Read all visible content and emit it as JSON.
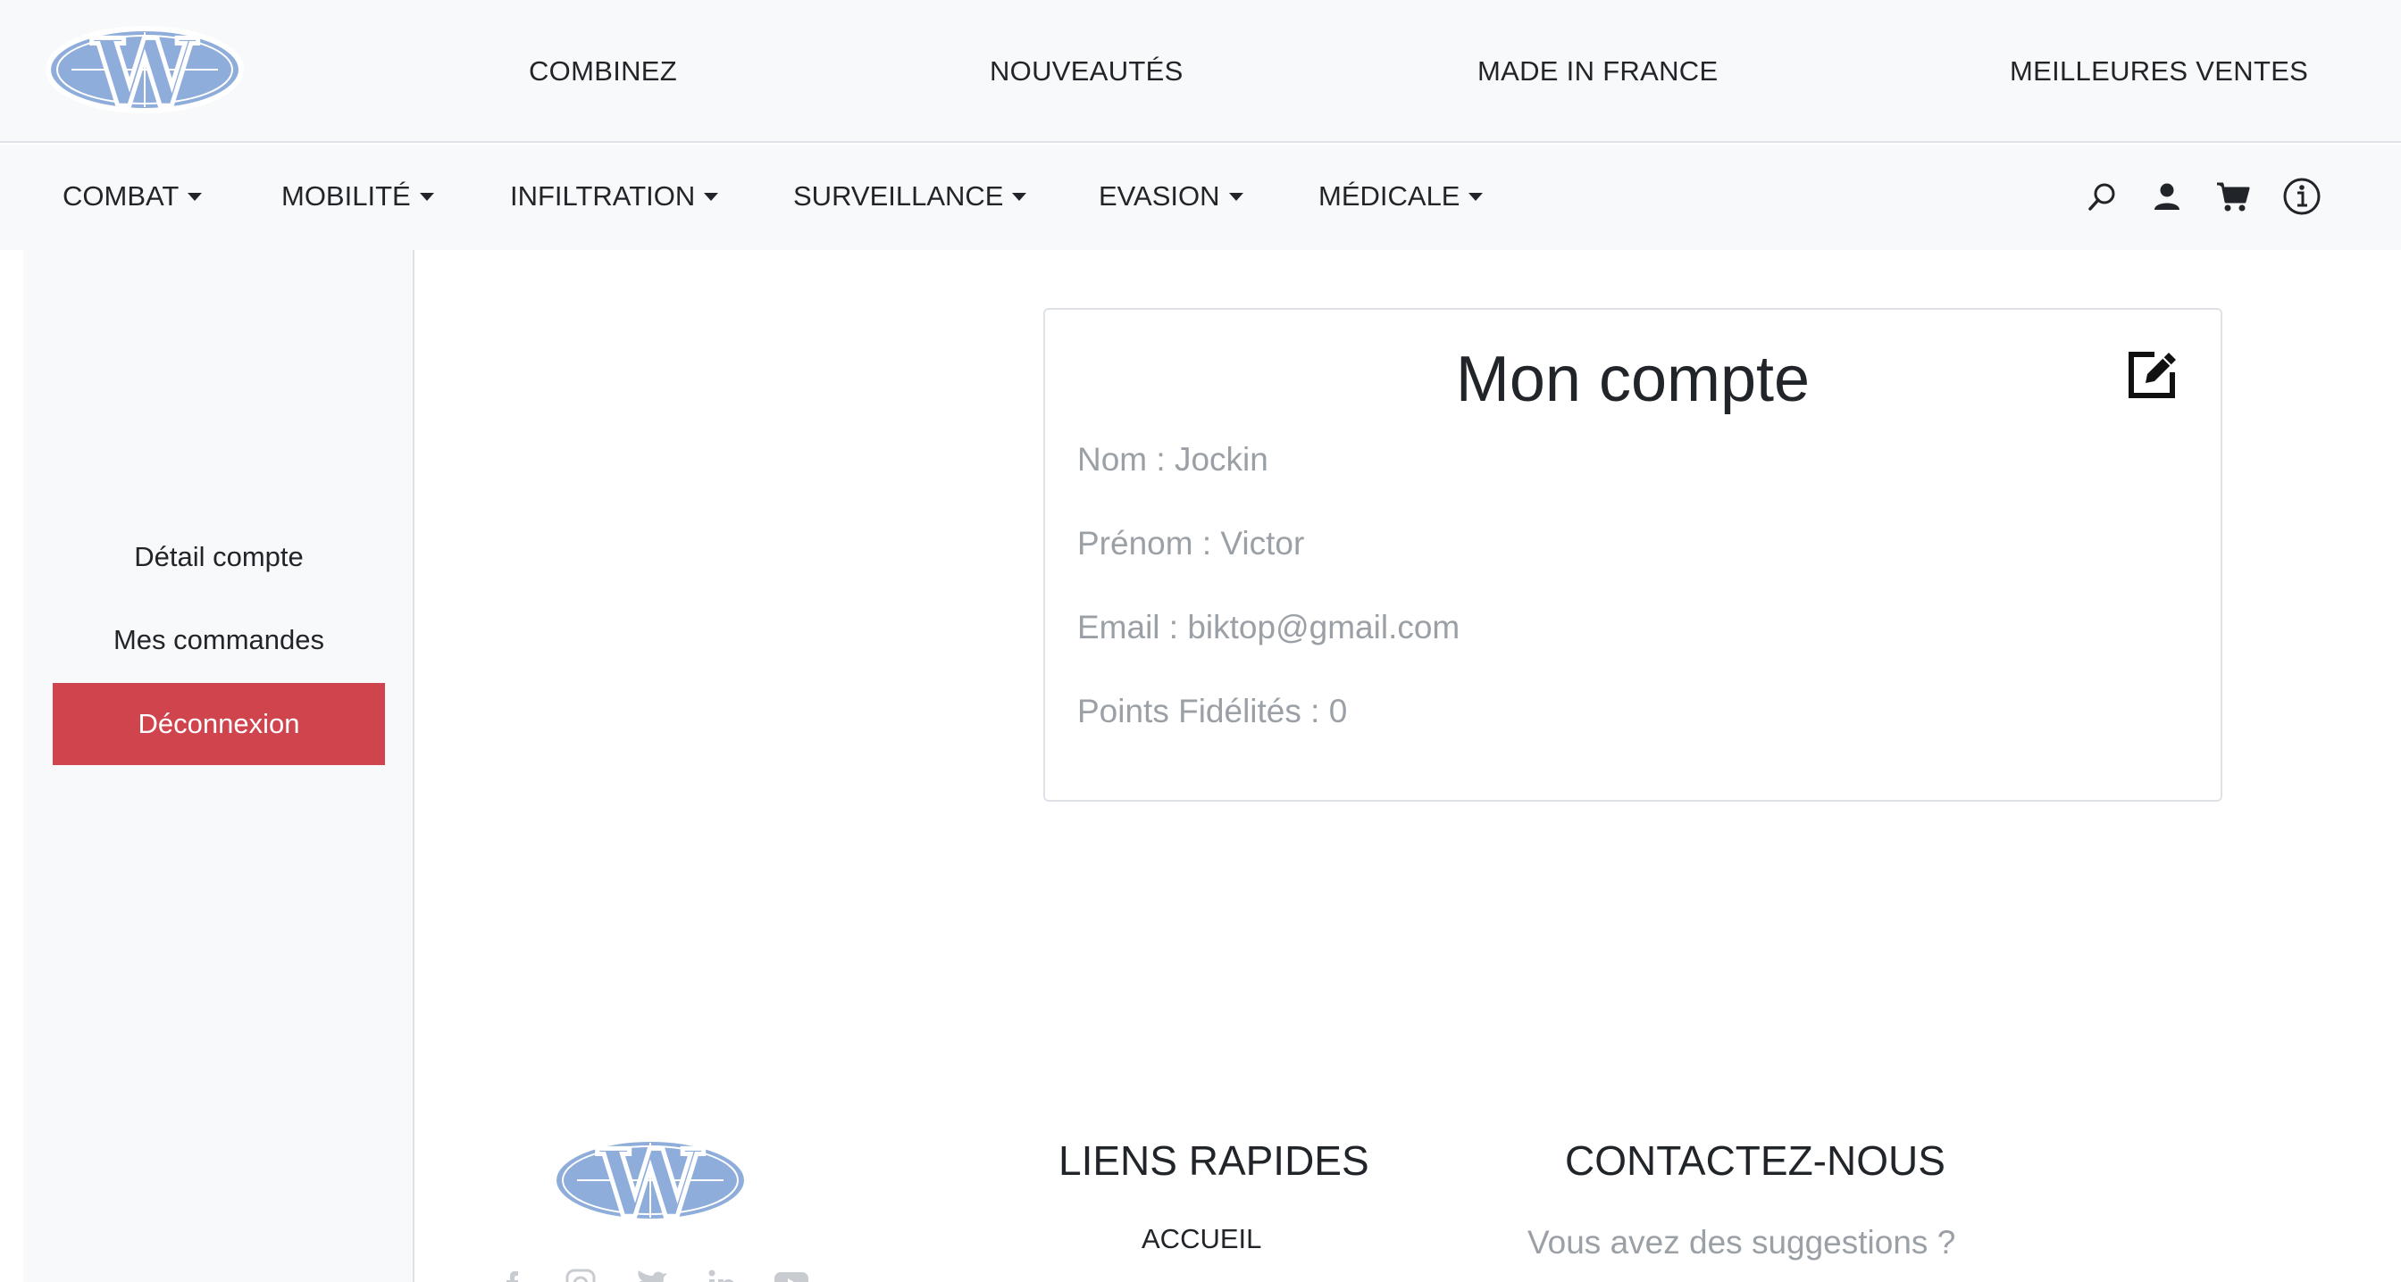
{
  "brand": {
    "logo_letter": "W",
    "accent": "#8fadda",
    "danger": "#cf444d"
  },
  "top_nav": [
    "COMBINEZ",
    "NOUVEAUTÉS",
    "MADE IN FRANCE",
    "MEILLEURES VENTES"
  ],
  "categories": [
    "COMBAT",
    "MOBILITÉ",
    "INFILTRATION",
    "SURVEILLANCE",
    "EVASION",
    "MÉDICALE"
  ],
  "nav_icons": [
    "search-icon",
    "user-icon",
    "cart-icon",
    "info-icon"
  ],
  "sidebar": {
    "items": [
      {
        "label": "Détail compte",
        "active": false
      },
      {
        "label": "Mes commandes",
        "active": false
      },
      {
        "label": "Déconnexion",
        "active": true
      }
    ]
  },
  "account": {
    "title": "Mon compte",
    "fields": [
      "Nom : Jockin",
      "Prénom : Victor",
      "Email : biktop@gmail.com",
      "Points Fidélités : 0"
    ]
  },
  "footer": {
    "quick_links_title": "LIENS RAPIDES",
    "quick_links": [
      "ACCUEIL"
    ],
    "contact_title": "CONTACTEZ-NOUS",
    "contact_text": "Vous avez des suggestions ?",
    "social_icons": [
      "facebook-icon",
      "instagram-icon",
      "twitter-icon",
      "linkedin-icon",
      "youtube-icon"
    ]
  }
}
